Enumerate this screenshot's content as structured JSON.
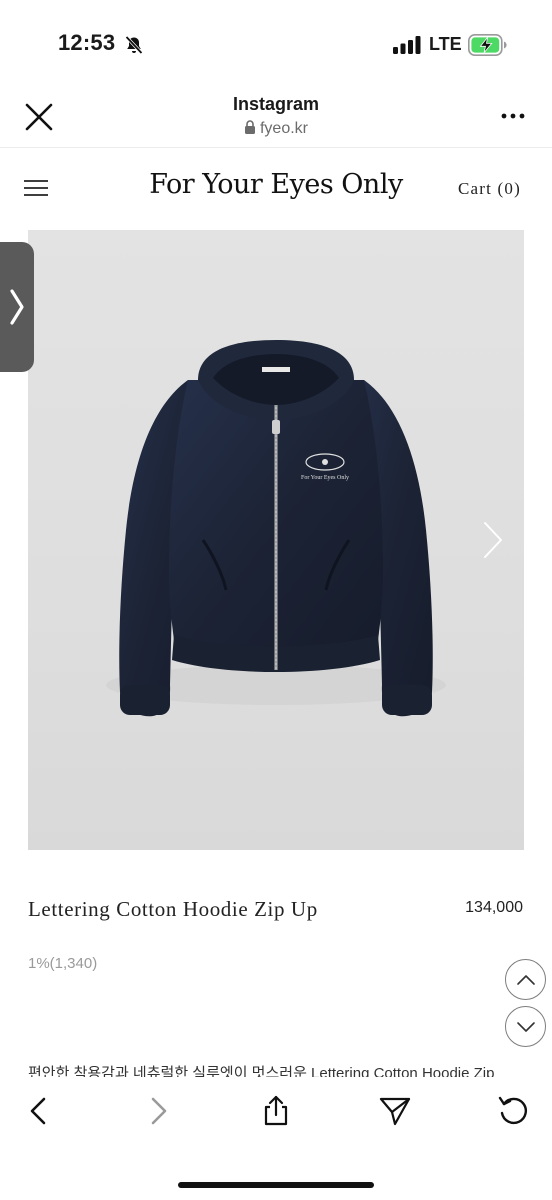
{
  "status_bar": {
    "time": "12:53",
    "carrier": "LTE",
    "icons": [
      "bell-slash-icon",
      "signal-bars-icon",
      "battery-charging-icon"
    ],
    "battery_color": "#4cd964"
  },
  "browser": {
    "title": "Instagram",
    "url": "fyeo.kr",
    "close_icon": "close-icon",
    "more_icon": "more-icon"
  },
  "site_nav": {
    "logo": "For Your Eyes Only",
    "cart": "Cart (0)",
    "menu_icon": "hamburger-icon"
  },
  "product": {
    "image_alt": "navy zip-up hoodie",
    "image_text": "For Your Eyes Only",
    "name": "Lettering Cotton Hoodie Zip Up",
    "price": "134,000",
    "points": "1%(1,340)",
    "description": "편안한 착용감과 네츄럴한 실루엣이 멋스러운 Lettering Cotton Hoodie Zip"
  },
  "colors": {
    "hoodie_navy": "#1d2436",
    "background_gray": "#dedede",
    "zipper": "#b8b8b8",
    "muted_text": "#9a9a9a"
  },
  "toolbar": {
    "back": "chevron-left-icon",
    "forward": "chevron-right-icon",
    "share": "share-icon",
    "send": "send-icon",
    "reload": "reload-icon"
  }
}
